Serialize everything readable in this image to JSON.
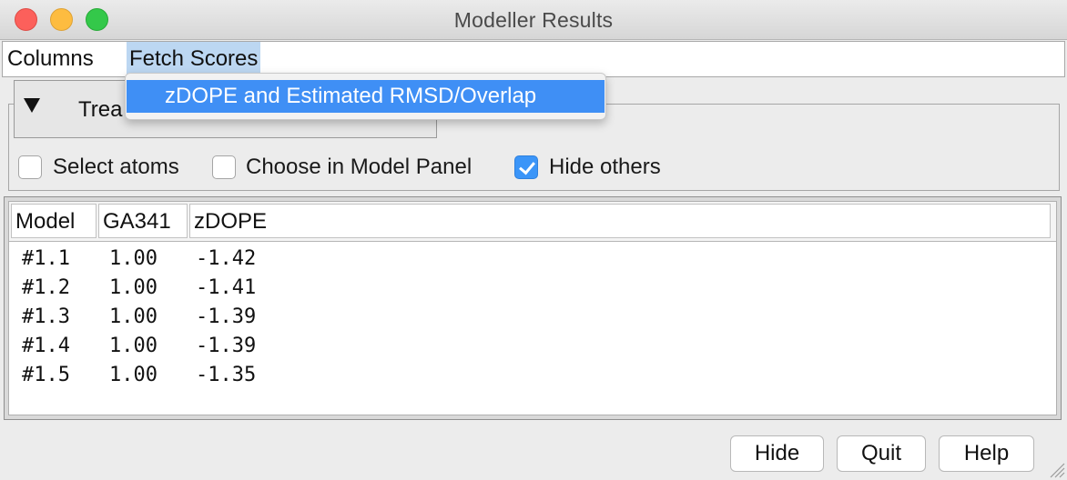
{
  "window": {
    "title": "Modeller Results"
  },
  "menubar": {
    "columns": "Columns",
    "fetch_scores": "Fetch Scores",
    "fetch_menu_items": [
      "zDOPE and Estimated RMSD/Overlap"
    ]
  },
  "treat": {
    "label": "Trea"
  },
  "options": {
    "select_atoms": {
      "label": "Select atoms",
      "checked": false
    },
    "choose_in_model_panel": {
      "label": "Choose in Model Panel",
      "checked": false
    },
    "hide_others": {
      "label": "Hide others",
      "checked": true
    }
  },
  "table": {
    "columns": [
      "Model",
      "GA341",
      "zDOPE"
    ],
    "rows": [
      [
        "#1.1",
        "1.00",
        "-1.42"
      ],
      [
        "#1.2",
        "1.00",
        "-1.41"
      ],
      [
        "#1.3",
        "1.00",
        "-1.39"
      ],
      [
        "#1.4",
        "1.00",
        "-1.39"
      ],
      [
        "#1.5",
        "1.00",
        "-1.35"
      ]
    ]
  },
  "buttons": {
    "hide": "Hide",
    "quit": "Quit",
    "help": "Help"
  },
  "colors": {
    "menu_highlight": "#bcd7f2",
    "dropdown_selected": "#3f8ff5",
    "checkbox_checked": "#3b95f8"
  }
}
